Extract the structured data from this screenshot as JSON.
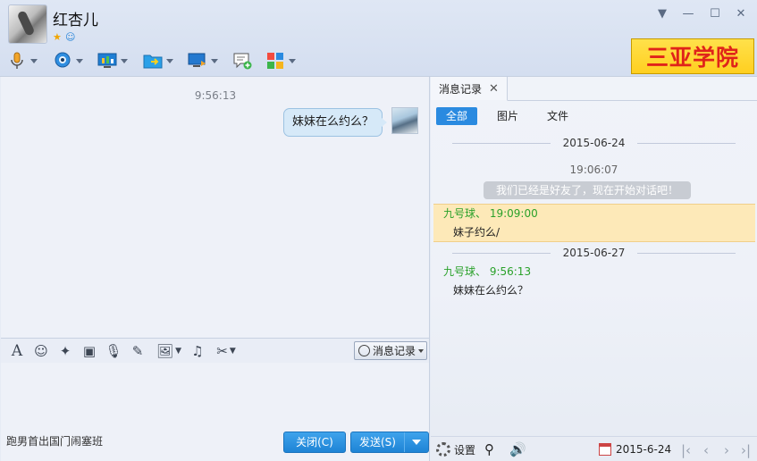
{
  "window": {
    "contact_name": "红杏儿",
    "banner_text": "三亚学院"
  },
  "chat": {
    "time": "9:56:13",
    "message": "妹妹在么约么？"
  },
  "input_toolbar": {
    "history_button": "消息记录"
  },
  "status_text": "跑男首出国门闹塞班",
  "buttons": {
    "close": "关闭(C)",
    "send": "发送(S)"
  },
  "history": {
    "tab_label": "消息记录",
    "filters": [
      "全部",
      "图片",
      "文件"
    ],
    "date1": "2015-06-24",
    "sys_time": "19:06:07",
    "sys_message": "我们已经是好友了，现在开始对话吧！",
    "msg1_sender": "九号球、 19:09:00",
    "msg1_text": "妹子约么/",
    "date2": "2015-06-27",
    "msg2_sender": "九号球、 9:56:13",
    "msg2_text": "妹妹在么约么？",
    "settings_label": "设置",
    "current_date": "2015-6-24"
  }
}
